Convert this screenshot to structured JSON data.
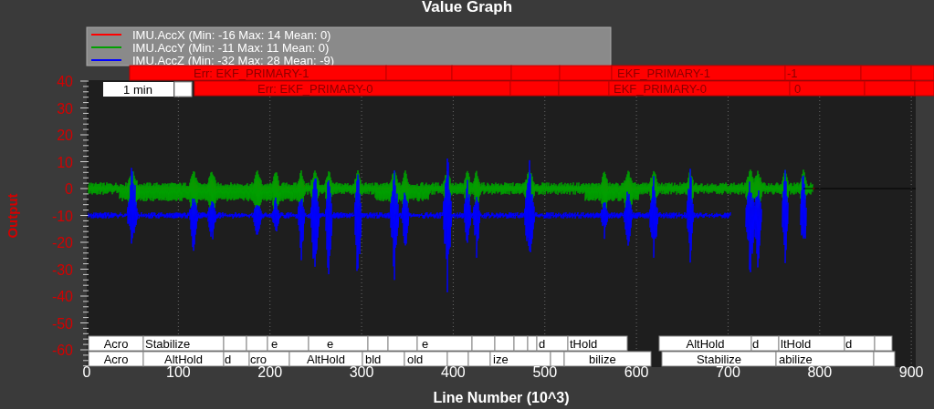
{
  "title": "Value Graph",
  "legend": [
    {
      "label": "IMU.AccX (Min: -16 Max: 14 Mean: 0)",
      "color": "#ff0000"
    },
    {
      "label": "IMU.AccY (Min: -11 Max: 11 Mean: 0)",
      "color": "#00a000"
    },
    {
      "label": "IMU.AccZ (Min: -32 Max: 28 Mean: -9)",
      "color": "#0000ff"
    }
  ],
  "time_scale": "1 min",
  "event_rows": [
    {
      "labels": [
        "Err: EKF_PRIMARY-1",
        "EKF_PRIMARY-1",
        "-1"
      ]
    },
    {
      "labels": [
        "Err: EKF_PRIMARY-0",
        "EKF_PRIMARY-0",
        "0"
      ]
    }
  ],
  "mode_rows": [
    {
      "labels": [
        "Acro",
        "Stabilize",
        "e",
        "e",
        "e",
        "d",
        "tHold",
        "AltHold",
        "d",
        "ltHold",
        "d"
      ]
    },
    {
      "labels": [
        "Acro",
        "AltHold",
        "d",
        "cro",
        "AltHold",
        "bld",
        "old",
        "ize",
        "bilize",
        "Stabilize",
        "abilize"
      ]
    }
  ],
  "y_axis": {
    "title": "Output",
    "ticks": [
      "40",
      "30",
      "20",
      "10",
      "0",
      "-10",
      "-20",
      "-30",
      "-40",
      "-50",
      "-60"
    ]
  },
  "x_axis": {
    "title": "Line Number (10^3)",
    "ticks": [
      "0",
      "100",
      "200",
      "300",
      "400",
      "500",
      "600",
      "700",
      "800",
      "900"
    ]
  }
}
